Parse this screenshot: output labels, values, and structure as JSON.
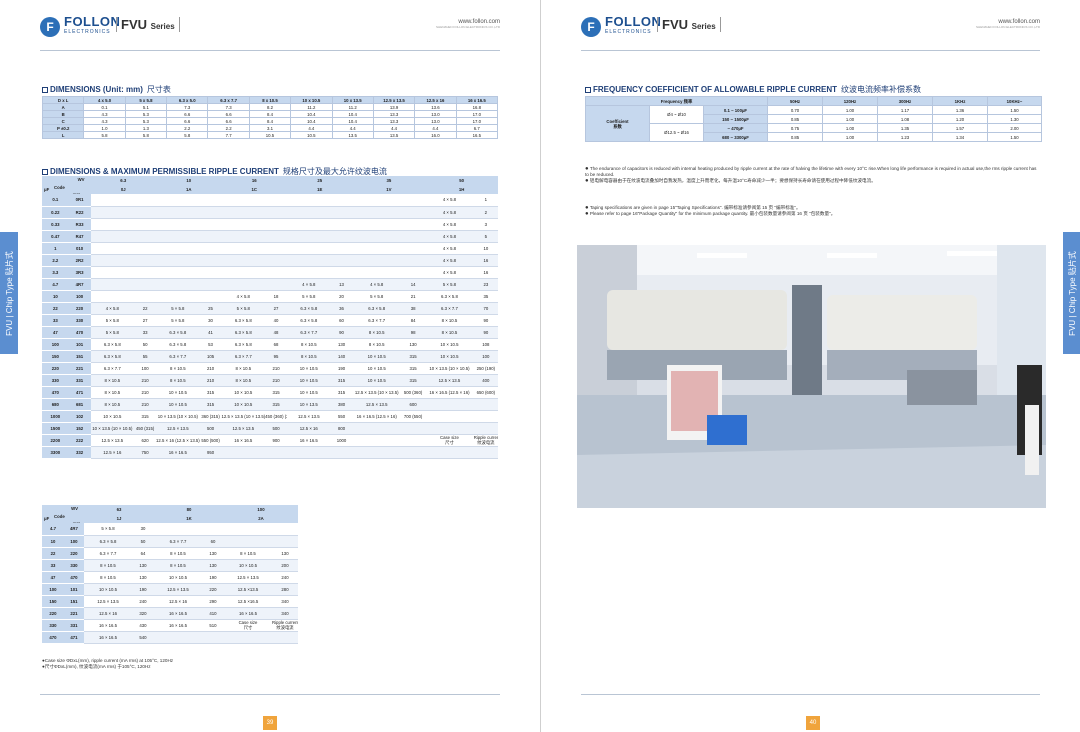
{
  "brand": {
    "logo_mark": "F",
    "name": "FOLLON",
    "sub": "ELECTRONICS",
    "series": "FVU",
    "series_word": "Series",
    "url": "www.follon.com",
    "url_sub": "SHENZHEN FOLLON ELECTRONICS CO.,LTD"
  },
  "side_tab": "FVU | Chip Type 贴片式",
  "left": {
    "page_number": "39",
    "dim_title": "DIMENSIONS (Unit: mm)",
    "dim_title_cn": "尺寸表",
    "dim_header": [
      "D x L",
      "4 x 5.0",
      "5 x 5.8",
      "6.3 x 5.0",
      "6.3 x 7.7",
      "8 x 10.5",
      "10 x 10.5",
      "10 x 13.5",
      "12.5 x 13.5",
      "12.5 x 16",
      "16 x 16.5"
    ],
    "dim_rows": [
      [
        "A",
        "0.1",
        "5.1",
        "7.3",
        "7.3",
        "8.2",
        "11.2",
        "11.2",
        "13.9",
        "13.6",
        "16.8"
      ],
      [
        "B",
        "4.3",
        "5.3",
        "6.6",
        "6.6",
        "8.4",
        "10.4",
        "10.4",
        "13.3",
        "13.0",
        "17.0"
      ],
      [
        "C",
        "4.3",
        "5.3",
        "6.6",
        "6.6",
        "8.4",
        "10.4",
        "10.4",
        "13.3",
        "13.0",
        "17.0"
      ],
      [
        "P ±0.2",
        "1.0",
        "1.3",
        "2.2",
        "2.2",
        "3.1",
        "4.4",
        "4.4",
        "4.4",
        "4.4",
        "6.7"
      ],
      [
        "L",
        "5.8",
        "5.8",
        "5.8",
        "7.7",
        "10.5",
        "10.5",
        "13.5",
        "13.5",
        "16.0",
        "16.5"
      ]
    ],
    "ripple_title": "DIMENSIONS & MAXIMUM PERMISSIBLE RIPPLE CURRENT",
    "ripple_title_cn": "规格尺寸及最大允许纹波电流",
    "corner": {
      "wv": "WV",
      "code": "Code",
      "code_cn": "代码",
      "uf": "μF"
    },
    "t1_voltages": [
      "6.3",
      "10",
      "16",
      "25",
      "35",
      "50"
    ],
    "t1_codes": [
      "0J",
      "1A",
      "1C",
      "1E",
      "1V",
      "1H"
    ],
    "t1_rows": [
      [
        "0.1",
        "0R1",
        "",
        "",
        "",
        "",
        "",
        "",
        "",
        "",
        "",
        "",
        "4 × 5.8",
        "1"
      ],
      [
        "0.22",
        "R22",
        "",
        "",
        "",
        "",
        "",
        "",
        "",
        "",
        "",
        "",
        "4 × 5.8",
        "2"
      ],
      [
        "0.33",
        "R33",
        "",
        "",
        "",
        "",
        "",
        "",
        "",
        "",
        "",
        "",
        "4 × 5.8",
        "3"
      ],
      [
        "0.47",
        "R47",
        "",
        "",
        "",
        "",
        "",
        "",
        "",
        "",
        "",
        "",
        "4 × 5.8",
        "5"
      ],
      [
        "1",
        "010",
        "",
        "",
        "",
        "",
        "",
        "",
        "",
        "",
        "",
        "",
        "4 × 5.8",
        "10"
      ],
      [
        "2.2",
        "2R2",
        "",
        "",
        "",
        "",
        "",
        "",
        "",
        "",
        "",
        "",
        "4 × 5.8",
        "16"
      ],
      [
        "3.3",
        "3R3",
        "",
        "",
        "",
        "",
        "",
        "",
        "",
        "",
        "",
        "",
        "4 × 5.8",
        "16"
      ],
      [
        "4.7",
        "4R7",
        "",
        "",
        "",
        "",
        "",
        "",
        "4 × 5.8",
        "13",
        "4 × 5.8",
        "14",
        "5 × 5.8",
        "23"
      ],
      [
        "10",
        "100",
        "",
        "",
        "",
        "",
        "4 × 5.8",
        "18",
        "5 × 5.8",
        "20",
        "5 × 5.8",
        "21",
        "6.3 × 5.8",
        "35"
      ],
      [
        "22",
        "220",
        "4 × 5.8",
        "22",
        "5 × 5.8",
        "25",
        "5 × 5.8",
        "27",
        "6.3 × 5.8",
        "36",
        "6.3 × 5.8",
        "38",
        "6.3 × 7.7",
        "70"
      ],
      [
        "33",
        "330",
        "5 × 5.8",
        "27",
        "5 × 5.8",
        "30",
        "6.3 × 5.8",
        "40",
        "6.3 × 5.8",
        "60",
        "6.3 × 7.7",
        "84",
        "8 × 10.5",
        "90"
      ],
      [
        "47",
        "470",
        "5 × 5.8",
        "33",
        "6.3 × 5.8",
        "41",
        "6.3 × 5.8",
        "48",
        "6.3 × 7.7",
        "90",
        "8 × 10.5",
        "98",
        "8 × 10.5",
        "90"
      ],
      [
        "100",
        "101",
        "6.3 × 5.8",
        "50",
        "6.3 × 5.8",
        "53",
        "6.3 × 5.8",
        "68",
        "8 × 10.5",
        "130",
        "8 × 10.5",
        "130",
        "10 × 10.5",
        "108"
      ],
      [
        "150",
        "151",
        "6.3 × 5.8",
        "55",
        "6.3 × 7.7",
        "105",
        "6.3 × 7.7",
        "95",
        "8 × 10.5",
        "140",
        "10 × 10.5",
        "315",
        "10 × 10.5",
        "100"
      ],
      [
        "220",
        "221",
        "6.3 × 7.7",
        "100",
        "8 × 10.5",
        "210",
        "8 × 10.5",
        "210",
        "10 × 10.5",
        "190",
        "10 × 10.5",
        "315",
        "10 × 13.5 (10 × 10.5)",
        "250 (190)"
      ],
      [
        "330",
        "331",
        "8 × 10.5",
        "210",
        "8 × 10.5",
        "210",
        "8 × 10.5",
        "210",
        "10 × 10.5",
        "315",
        "10 × 10.5",
        "315",
        "12.5 × 13.5",
        "400"
      ],
      [
        "470",
        "471",
        "8 × 10.5",
        "210",
        "10 × 10.5",
        "315",
        "10 × 10.5",
        "315",
        "10 × 10.5",
        "315",
        "12.5 × 13.5 (10 × 13.5)",
        "500 (360)",
        "16 × 16.5 (12.5 × 16)",
        "650 (600)"
      ],
      [
        "680",
        "681",
        "8 × 10.5",
        "210",
        "10 × 10.5",
        "315",
        "10 × 10.5",
        "315",
        "10 × 13.5",
        "380",
        "12.5 × 13.5",
        "600",
        "",
        ""
      ],
      [
        "1000",
        "102",
        "10 × 10.5",
        "315",
        "10 × 13.5 (10 × 10.5)",
        "360 (315)",
        "12.5 × 13.5 (10 × 13.5) (10 × 10.5)",
        "450 (360) (315)",
        "12.5 × 13.5",
        "550",
        "16 × 16.5 (12.5 × 16)",
        "700 (550)",
        "",
        ""
      ],
      [
        "1500",
        "152",
        "10 × 13.5 (10 × 10.5)",
        "450 (315)",
        "12.5 × 13.5",
        "500",
        "12.5 × 13.5",
        "500",
        "12.5 × 16",
        "800",
        "",
        "",
        "",
        ""
      ],
      [
        "2200",
        "222",
        "12.5 × 13.5",
        "620",
        "12.5 × 16 (12.5 × 13.5)",
        "550 (500)",
        "16 × 16.5",
        "900",
        "16 × 16.5",
        "1000",
        "",
        "",
        "",
        ""
      ],
      [
        "3300",
        "332",
        "12.5 × 16",
        "750",
        "16 × 16.5",
        "950",
        "",
        "",
        "",
        "",
        "",
        "",
        "",
        ""
      ]
    ],
    "t1_legend": {
      "case": "Case size",
      "case_cn": "尺寸",
      "ripple": "Ripple current",
      "ripple_cn": "纹波电流"
    },
    "t2_voltages": [
      "63",
      "80",
      "100"
    ],
    "t2_codes": [
      "1J",
      "1K",
      "2A"
    ],
    "t2_rows": [
      [
        "4.7",
        "4R7",
        "5 × 5.8",
        "30",
        "",
        "",
        "",
        ""
      ],
      [
        "10",
        "100",
        "6.3 × 5.8",
        "50",
        "6.3 × 7.7",
        "60",
        "",
        ""
      ],
      [
        "22",
        "220",
        "6.3 × 7.7",
        "64",
        "8 × 10.5",
        "130",
        "8 × 10.5",
        "130"
      ],
      [
        "33",
        "330",
        "8 × 10.5",
        "130",
        "8 × 10.5",
        "130",
        "10 × 10.5",
        "200"
      ],
      [
        "47",
        "470",
        "8 × 10.5",
        "130",
        "10 × 10.5",
        "190",
        "12.5 × 13.5",
        "240"
      ],
      [
        "100",
        "101",
        "10 × 10.5",
        "190",
        "12.5 × 13.5",
        "220",
        "12.5 ×13.5",
        "280"
      ],
      [
        "150",
        "151",
        "12.5 × 13.5",
        "240",
        "12.5 × 16",
        "290",
        "12.5 ×16.5",
        "340"
      ],
      [
        "220",
        "221",
        "12.5 × 16",
        "320",
        "16 × 16.5",
        "410",
        "16 × 16.5",
        "340"
      ],
      [
        "330",
        "331",
        "16 × 16.5",
        "430",
        "16 × 16.5",
        "510",
        "",
        ""
      ],
      [
        "470",
        "471",
        "16 × 16.5",
        "540",
        "",
        "",
        "",
        ""
      ]
    ],
    "t2_legend": {
      "case": "Case size",
      "case_cn": "尺寸",
      "ripple": "Ripple current",
      "ripple_cn": "纹波电流"
    },
    "footnotes": [
      "●Case size ΦDxL(mm), ripple current (mA rms) at 105°C, 120Hz",
      "●尺寸ΦDxL(mm), 纹波电流(mA rms) 于105°C, 120Hz"
    ]
  },
  "right": {
    "page_number": "40",
    "freq_title": "FREQUENCY COEFFICIENT OF ALLOWABLE RIPPLE CURRENT",
    "freq_title_cn": "纹波电流频率补偿系数",
    "freq_label": "Frequency 频率",
    "freq_headers": [
      "50Hz",
      "120Hz",
      "300Hz",
      "1KHz",
      "10KHz~"
    ],
    "coef_label": "Coefficient",
    "coef_label_cn": "系数",
    "groups": [
      {
        "dia": "Ø4 ~ Ø10",
        "rows": [
          {
            "cap": "0.1 ~ 100µF",
            "vals": [
              "0.70",
              "1.00",
              "1.17",
              "1.36",
              "1.50"
            ]
          },
          {
            "cap": "150 ~ 1500µF",
            "vals": [
              "0.85",
              "1.00",
              "1.08",
              "1.20",
              "1.30"
            ]
          }
        ]
      },
      {
        "dia": "Ø12.5 ~ Ø16",
        "rows": [
          {
            "cap": "~ 470µF",
            "vals": [
              "0.75",
              "1.00",
              "1.35",
              "1.57",
              "2.00"
            ]
          },
          {
            "cap": "680 ~ 3300µF",
            "vals": [
              "0.85",
              "1.00",
              "1.23",
              "1.34",
              "1.50"
            ]
          }
        ]
      }
    ],
    "note1": "The endurance of capacitors is reduced with internal heating produced by ripple current at the rate of halving the lifetime with every 10°C rise.When long life performance is required in actual use,the rms ripple current has to be reduced.",
    "note1_cn": "铝电解电容器由于在纹波电流叠加时自我发热，温度上升而老化，每升温10°C寿命减少一半；要想保持长寿命请在使用过程中降低纹波电流。",
    "note2": "Taping specifications are given in page 15\"Taping Specifications\".  编带标准请参阅第 15 页 \"编带标准\"。",
    "note3": "Please refer to page 16\"Package Quantity\" for the minimum package quantity.  最小包装数量请参阅第 16 页 \"包装数量\"。",
    "colors": {
      "header_blue": "#c6d8ee",
      "title_navy": "#1f3f77",
      "page_orange": "#f0a43c",
      "tab_blue": "#5b8ed0"
    }
  }
}
